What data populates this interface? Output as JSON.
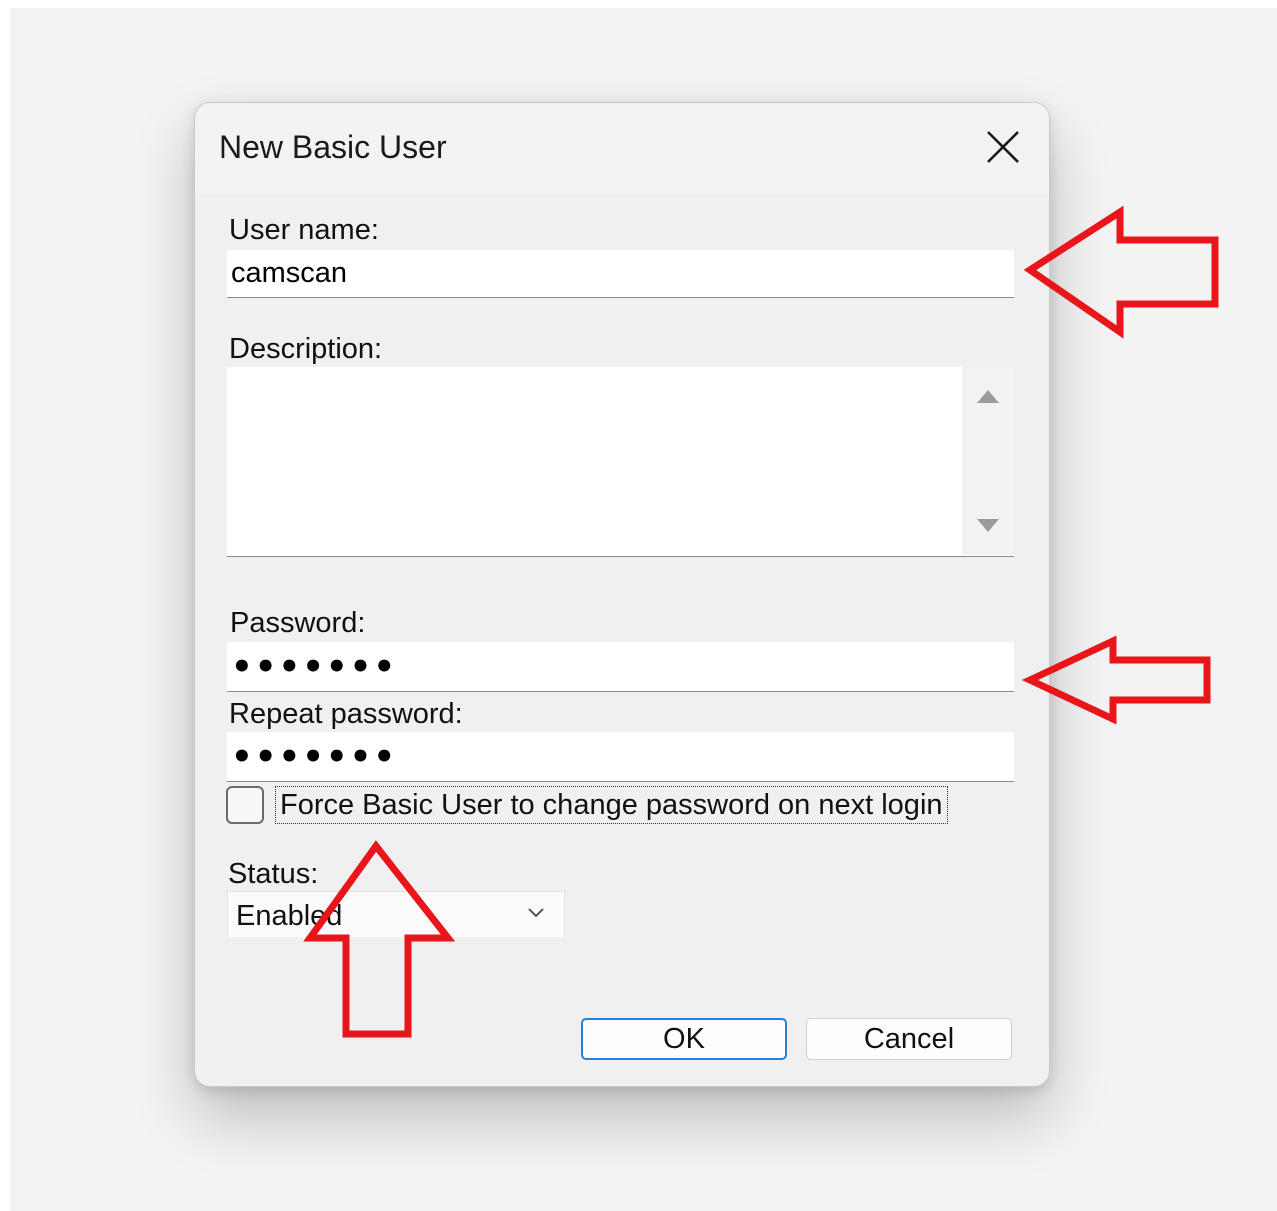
{
  "dialog": {
    "title": "New Basic User",
    "close_icon": "close-icon"
  },
  "form": {
    "username_label": "User name:",
    "username_value": "camscan",
    "description_label": "Description:",
    "description_value": "",
    "password_label": "Password:",
    "password_value": "•••••••",
    "repeat_password_label": "Repeat password:",
    "repeat_password_value": "•••••••",
    "force_change_label": "Force Basic User to change password on next login",
    "force_change_checked": false,
    "status_label": "Status:",
    "status_value": "Enabled"
  },
  "buttons": {
    "ok_label": "OK",
    "cancel_label": "Cancel"
  },
  "annotations": {
    "color": "#e8151b",
    "arrows": [
      "left-arrow",
      "left-arrow",
      "up-arrow"
    ]
  }
}
